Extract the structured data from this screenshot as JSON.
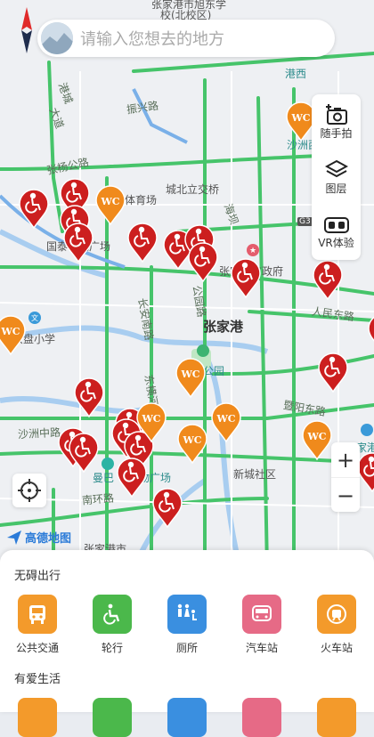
{
  "search": {
    "placeholder": "请输入您想去的地方"
  },
  "right_panel": {
    "items": [
      {
        "label": "随手拍",
        "icon": "camera-plus-icon"
      },
      {
        "label": "图层",
        "icon": "layers-icon"
      },
      {
        "label": "VR体验",
        "icon": "vr-goggles-icon"
      }
    ]
  },
  "zoom": {
    "in": "+",
    "out": "−"
  },
  "brand": {
    "name": "高德地图"
  },
  "map_labels": {
    "top_school": "张家港市旭东学",
    "top_school2": "校(北校区)",
    "gangxi": "港西",
    "zhenxing": "振兴路",
    "gangcheng1": "港城",
    "gangcheng2": "大道",
    "zhangyang": "张杨公路",
    "stadium": "体育场",
    "chengbei": "城北立交桥",
    "guotai": "国泰时代广场",
    "shazhouxi": "沙洲西",
    "gov": "张家港市政府",
    "haiba": "海坝",
    "g3": "G3",
    "renmin": "人民东路",
    "gongyuan": "公园路",
    "changan": "长安南路",
    "zhangjiagang": "张家港",
    "yunpan": "云盘小学",
    "park": "公园",
    "dongheng": "东横河",
    "jiyang": "暨阳东路",
    "shazhouzhong": "沙洲中路",
    "xincheng": "新城社区",
    "zhangjiagangdong": "张家港",
    "manbo": "曼巴",
    "wuguang": "物广场",
    "nanhuan": "南环路",
    "bottom_street": "张家港市"
  },
  "bottom_sheet": {
    "section1_title": "无碍出行",
    "section1_items": [
      {
        "label": "公共交通",
        "icon": "bus-icon",
        "color": "#f39a2b"
      },
      {
        "label": "轮行",
        "icon": "wheelchair-icon",
        "color": "#4bb84b"
      },
      {
        "label": "厕所",
        "icon": "restroom-icon",
        "color": "#3a8fe0"
      },
      {
        "label": "汽车站",
        "icon": "coach-icon",
        "color": "#e66a86"
      },
      {
        "label": "火车站",
        "icon": "train-icon",
        "color": "#f39a2b"
      }
    ],
    "section2_title": "有爱生活"
  },
  "colors": {
    "accessible_marker": "#cc1f1f",
    "wc_marker": "#f08a1c",
    "road_green": "#46c46a"
  }
}
